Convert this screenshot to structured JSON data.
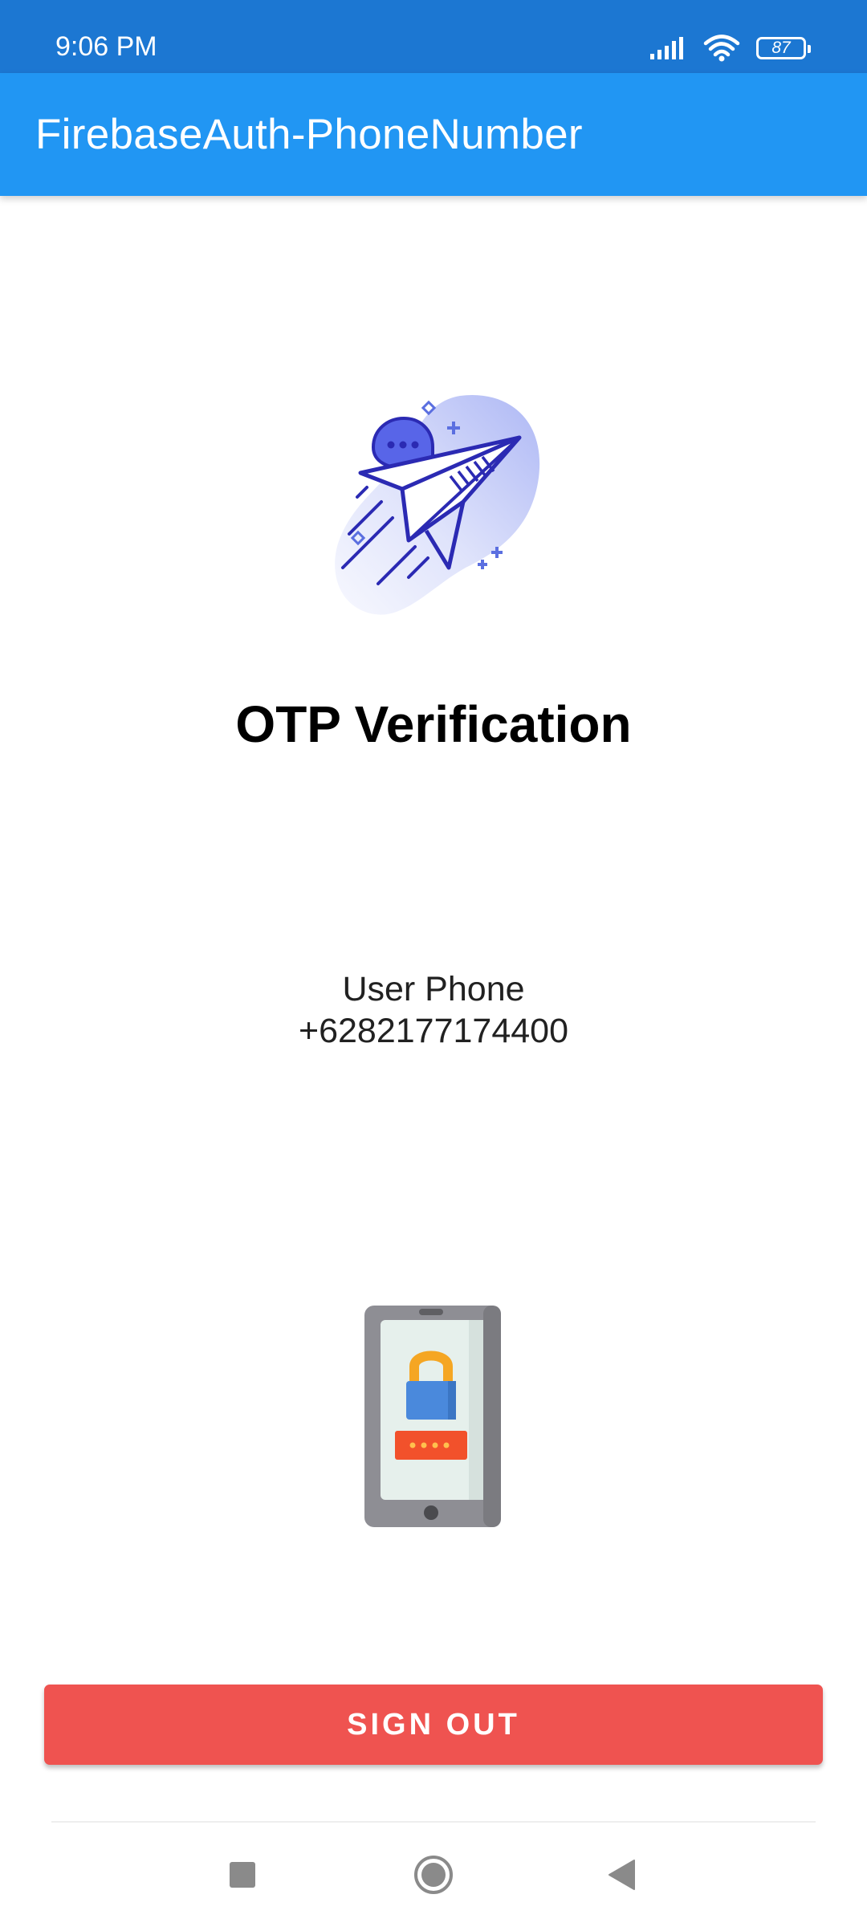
{
  "status_bar": {
    "time": "9:06 PM",
    "battery_level": "87",
    "background_color": "#1c77d2"
  },
  "app_bar": {
    "title": "FirebaseAuth-PhoneNumber",
    "background_color": "#2196f3"
  },
  "main": {
    "hero_icon": "paper-plane-chat-illustration",
    "heading": "OTP Verification",
    "phone_label": "User Phone",
    "phone_number": "+6282177174400",
    "lock_icon": "phone-lock-illustration"
  },
  "actions": {
    "sign_out_label": "SIGN OUT",
    "sign_out_color": "#ef5350"
  },
  "nav_bar": {
    "buttons": [
      "recents-icon",
      "home-icon",
      "back-icon"
    ]
  }
}
